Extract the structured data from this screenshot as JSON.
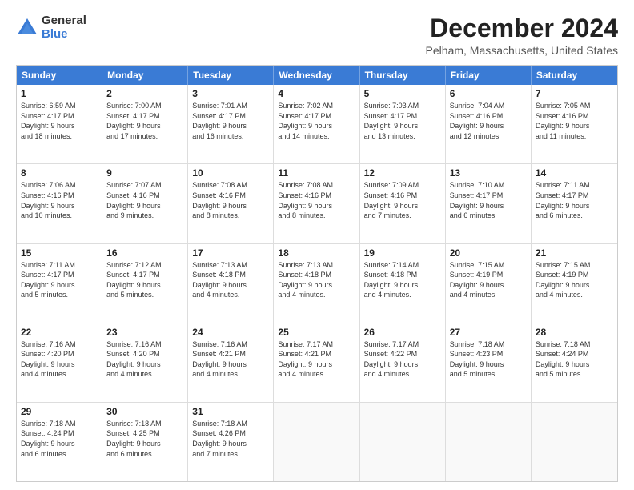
{
  "logo": {
    "general": "General",
    "blue": "Blue"
  },
  "title": {
    "main": "December 2024",
    "sub": "Pelham, Massachusetts, United States"
  },
  "calendar": {
    "headers": [
      "Sunday",
      "Monday",
      "Tuesday",
      "Wednesday",
      "Thursday",
      "Friday",
      "Saturday"
    ],
    "rows": [
      [
        {
          "day": "1",
          "text": "Sunrise: 6:59 AM\nSunset: 4:17 PM\nDaylight: 9 hours\nand 18 minutes."
        },
        {
          "day": "2",
          "text": "Sunrise: 7:00 AM\nSunset: 4:17 PM\nDaylight: 9 hours\nand 17 minutes."
        },
        {
          "day": "3",
          "text": "Sunrise: 7:01 AM\nSunset: 4:17 PM\nDaylight: 9 hours\nand 16 minutes."
        },
        {
          "day": "4",
          "text": "Sunrise: 7:02 AM\nSunset: 4:17 PM\nDaylight: 9 hours\nand 14 minutes."
        },
        {
          "day": "5",
          "text": "Sunrise: 7:03 AM\nSunset: 4:17 PM\nDaylight: 9 hours\nand 13 minutes."
        },
        {
          "day": "6",
          "text": "Sunrise: 7:04 AM\nSunset: 4:16 PM\nDaylight: 9 hours\nand 12 minutes."
        },
        {
          "day": "7",
          "text": "Sunrise: 7:05 AM\nSunset: 4:16 PM\nDaylight: 9 hours\nand 11 minutes."
        }
      ],
      [
        {
          "day": "8",
          "text": "Sunrise: 7:06 AM\nSunset: 4:16 PM\nDaylight: 9 hours\nand 10 minutes."
        },
        {
          "day": "9",
          "text": "Sunrise: 7:07 AM\nSunset: 4:16 PM\nDaylight: 9 hours\nand 9 minutes."
        },
        {
          "day": "10",
          "text": "Sunrise: 7:08 AM\nSunset: 4:16 PM\nDaylight: 9 hours\nand 8 minutes."
        },
        {
          "day": "11",
          "text": "Sunrise: 7:08 AM\nSunset: 4:16 PM\nDaylight: 9 hours\nand 8 minutes."
        },
        {
          "day": "12",
          "text": "Sunrise: 7:09 AM\nSunset: 4:16 PM\nDaylight: 9 hours\nand 7 minutes."
        },
        {
          "day": "13",
          "text": "Sunrise: 7:10 AM\nSunset: 4:17 PM\nDaylight: 9 hours\nand 6 minutes."
        },
        {
          "day": "14",
          "text": "Sunrise: 7:11 AM\nSunset: 4:17 PM\nDaylight: 9 hours\nand 6 minutes."
        }
      ],
      [
        {
          "day": "15",
          "text": "Sunrise: 7:11 AM\nSunset: 4:17 PM\nDaylight: 9 hours\nand 5 minutes."
        },
        {
          "day": "16",
          "text": "Sunrise: 7:12 AM\nSunset: 4:17 PM\nDaylight: 9 hours\nand 5 minutes."
        },
        {
          "day": "17",
          "text": "Sunrise: 7:13 AM\nSunset: 4:18 PM\nDaylight: 9 hours\nand 4 minutes."
        },
        {
          "day": "18",
          "text": "Sunrise: 7:13 AM\nSunset: 4:18 PM\nDaylight: 9 hours\nand 4 minutes."
        },
        {
          "day": "19",
          "text": "Sunrise: 7:14 AM\nSunset: 4:18 PM\nDaylight: 9 hours\nand 4 minutes."
        },
        {
          "day": "20",
          "text": "Sunrise: 7:15 AM\nSunset: 4:19 PM\nDaylight: 9 hours\nand 4 minutes."
        },
        {
          "day": "21",
          "text": "Sunrise: 7:15 AM\nSunset: 4:19 PM\nDaylight: 9 hours\nand 4 minutes."
        }
      ],
      [
        {
          "day": "22",
          "text": "Sunrise: 7:16 AM\nSunset: 4:20 PM\nDaylight: 9 hours\nand 4 minutes."
        },
        {
          "day": "23",
          "text": "Sunrise: 7:16 AM\nSunset: 4:20 PM\nDaylight: 9 hours\nand 4 minutes."
        },
        {
          "day": "24",
          "text": "Sunrise: 7:16 AM\nSunset: 4:21 PM\nDaylight: 9 hours\nand 4 minutes."
        },
        {
          "day": "25",
          "text": "Sunrise: 7:17 AM\nSunset: 4:21 PM\nDaylight: 9 hours\nand 4 minutes."
        },
        {
          "day": "26",
          "text": "Sunrise: 7:17 AM\nSunset: 4:22 PM\nDaylight: 9 hours\nand 4 minutes."
        },
        {
          "day": "27",
          "text": "Sunrise: 7:18 AM\nSunset: 4:23 PM\nDaylight: 9 hours\nand 5 minutes."
        },
        {
          "day": "28",
          "text": "Sunrise: 7:18 AM\nSunset: 4:24 PM\nDaylight: 9 hours\nand 5 minutes."
        }
      ],
      [
        {
          "day": "29",
          "text": "Sunrise: 7:18 AM\nSunset: 4:24 PM\nDaylight: 9 hours\nand 6 minutes."
        },
        {
          "day": "30",
          "text": "Sunrise: 7:18 AM\nSunset: 4:25 PM\nDaylight: 9 hours\nand 6 minutes."
        },
        {
          "day": "31",
          "text": "Sunrise: 7:18 AM\nSunset: 4:26 PM\nDaylight: 9 hours\nand 7 minutes."
        },
        {
          "day": "",
          "text": ""
        },
        {
          "day": "",
          "text": ""
        },
        {
          "day": "",
          "text": ""
        },
        {
          "day": "",
          "text": ""
        }
      ]
    ]
  }
}
